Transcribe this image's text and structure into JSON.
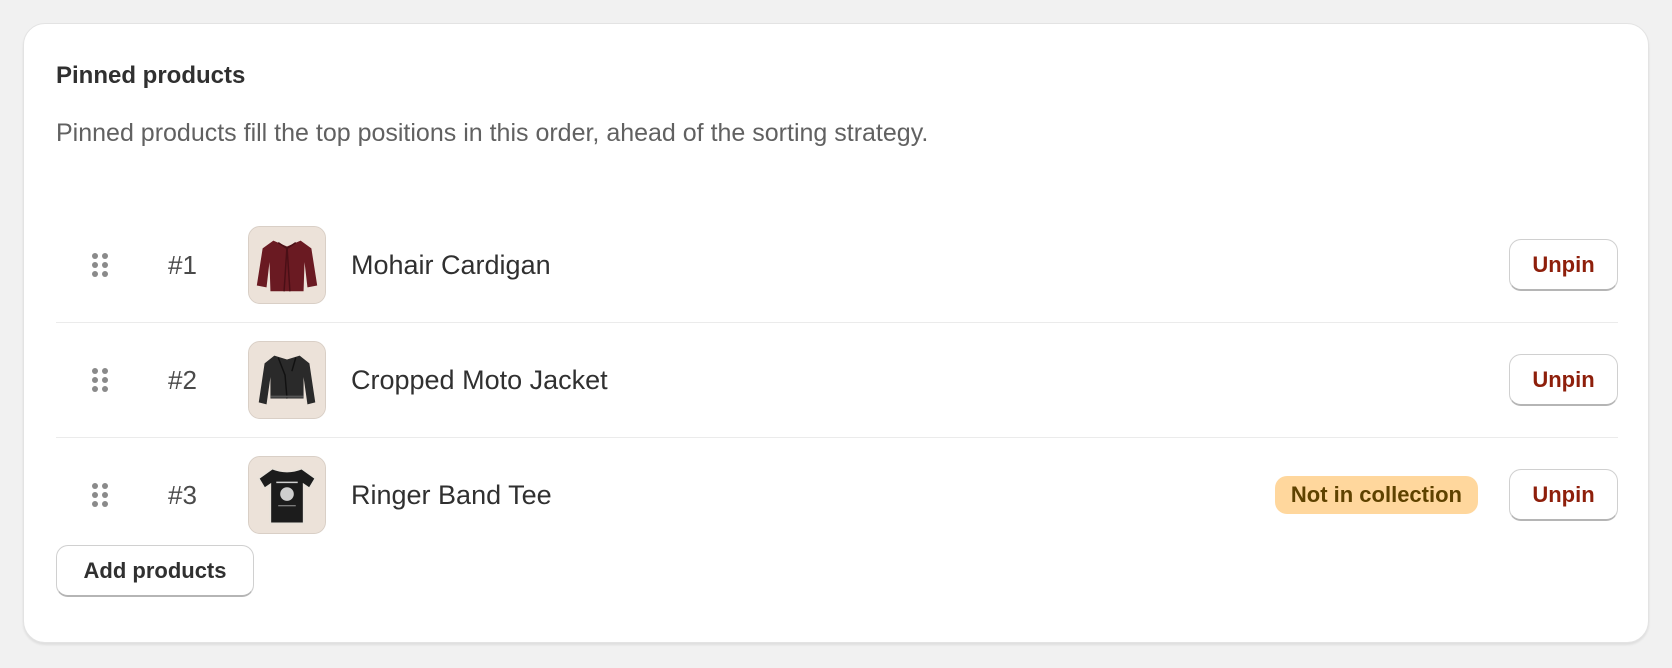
{
  "card": {
    "title": "Pinned products",
    "description": "Pinned products fill the top positions in this order, ahead of the sorting strategy."
  },
  "items": [
    {
      "rank": "#1",
      "name": "Mohair Cardigan",
      "thumbnail": "cardigan-image",
      "badge": "",
      "unpin_label": "Unpin"
    },
    {
      "rank": "#2",
      "name": "Cropped Moto Jacket",
      "thumbnail": "moto-jacket-image",
      "badge": "",
      "unpin_label": "Unpin"
    },
    {
      "rank": "#3",
      "name": "Ringer Band Tee",
      "thumbnail": "band-tee-image",
      "badge": "Not in collection",
      "unpin_label": "Unpin"
    }
  ],
  "actions": {
    "add_label": "Add products"
  },
  "icons": {
    "drag_handle": "drag-handle-icon"
  },
  "colors": {
    "badge_bg": "#ffd79d",
    "badge_text": "#5e4200",
    "unpin_text": "#8e1f0b"
  }
}
